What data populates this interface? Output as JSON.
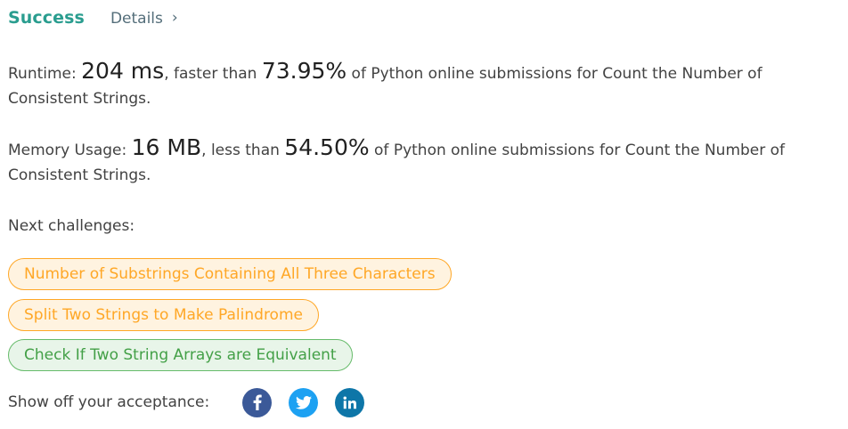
{
  "header": {
    "status": "Success",
    "details_label": "Details",
    "details_chevron": "›"
  },
  "runtime": {
    "label": "Runtime:",
    "value": "204 ms",
    "comparison": ", faster than",
    "percent": "73.95%",
    "suffix": "of Python online submissions for Count the Number of Consistent Strings."
  },
  "memory": {
    "label": "Memory Usage:",
    "value": "16 MB",
    "comparison": ", less than",
    "percent": "54.50%",
    "suffix": "of Python online submissions for Count the Number of Consistent Strings."
  },
  "next": {
    "label": "Next challenges:",
    "challenges": [
      {
        "title": "Number of Substrings Containing All Three Characters",
        "difficulty": "medium"
      },
      {
        "title": "Split Two Strings to Make Palindrome",
        "difficulty": "medium"
      },
      {
        "title": "Check If Two String Arrays are Equivalent",
        "difficulty": "easy"
      }
    ]
  },
  "share": {
    "label": "Show off your acceptance:",
    "networks": [
      {
        "icon": "facebook-icon",
        "color": "#3b5998"
      },
      {
        "icon": "twitter-icon",
        "color": "#1da1f2"
      },
      {
        "icon": "linkedin-icon",
        "color": "#0e76a8"
      }
    ]
  },
  "colors": {
    "success": "#2a9d8f",
    "medium_border": "#ffa726",
    "easy_border": "#66bb6a"
  }
}
